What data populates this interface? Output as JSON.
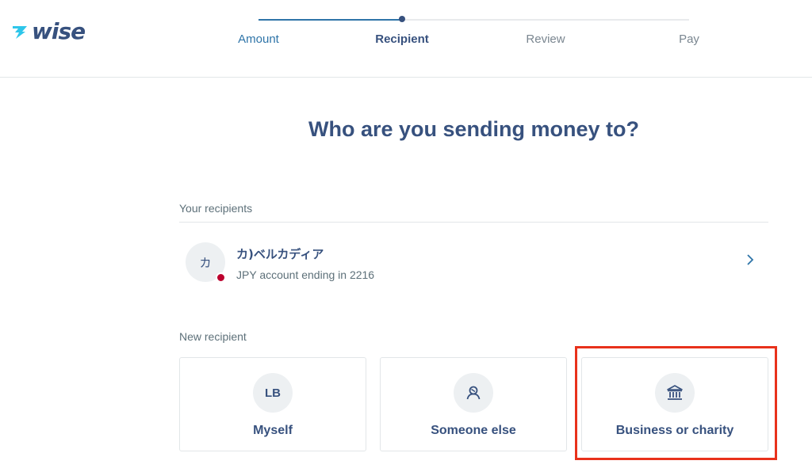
{
  "header": {
    "logo_text": "wise",
    "steps": [
      {
        "label": "Amount",
        "state": "done"
      },
      {
        "label": "Recipient",
        "state": "current"
      },
      {
        "label": "Review",
        "state": "todo"
      },
      {
        "label": "Pay",
        "state": "todo"
      }
    ]
  },
  "main": {
    "title": "Who are you sending money to?",
    "your_recipients": {
      "label": "Your recipients",
      "items": [
        {
          "initial": "カ",
          "name": "カ)ベルカディア",
          "subtitle": "JPY account ending in 2216",
          "flag": "japan-flag-icon"
        }
      ]
    },
    "new_recipient": {
      "label": "New recipient",
      "options": [
        {
          "label": "Myself",
          "icon_text": "LB",
          "icon": "initials-avatar"
        },
        {
          "label": "Someone else",
          "icon": "person-icon"
        },
        {
          "label": "Business or charity",
          "icon": "bank-icon"
        }
      ]
    }
  },
  "colors": {
    "primary": "#37517e",
    "accent": "#2e74a8",
    "muted": "#5d7079",
    "highlight": "#e8311b"
  }
}
